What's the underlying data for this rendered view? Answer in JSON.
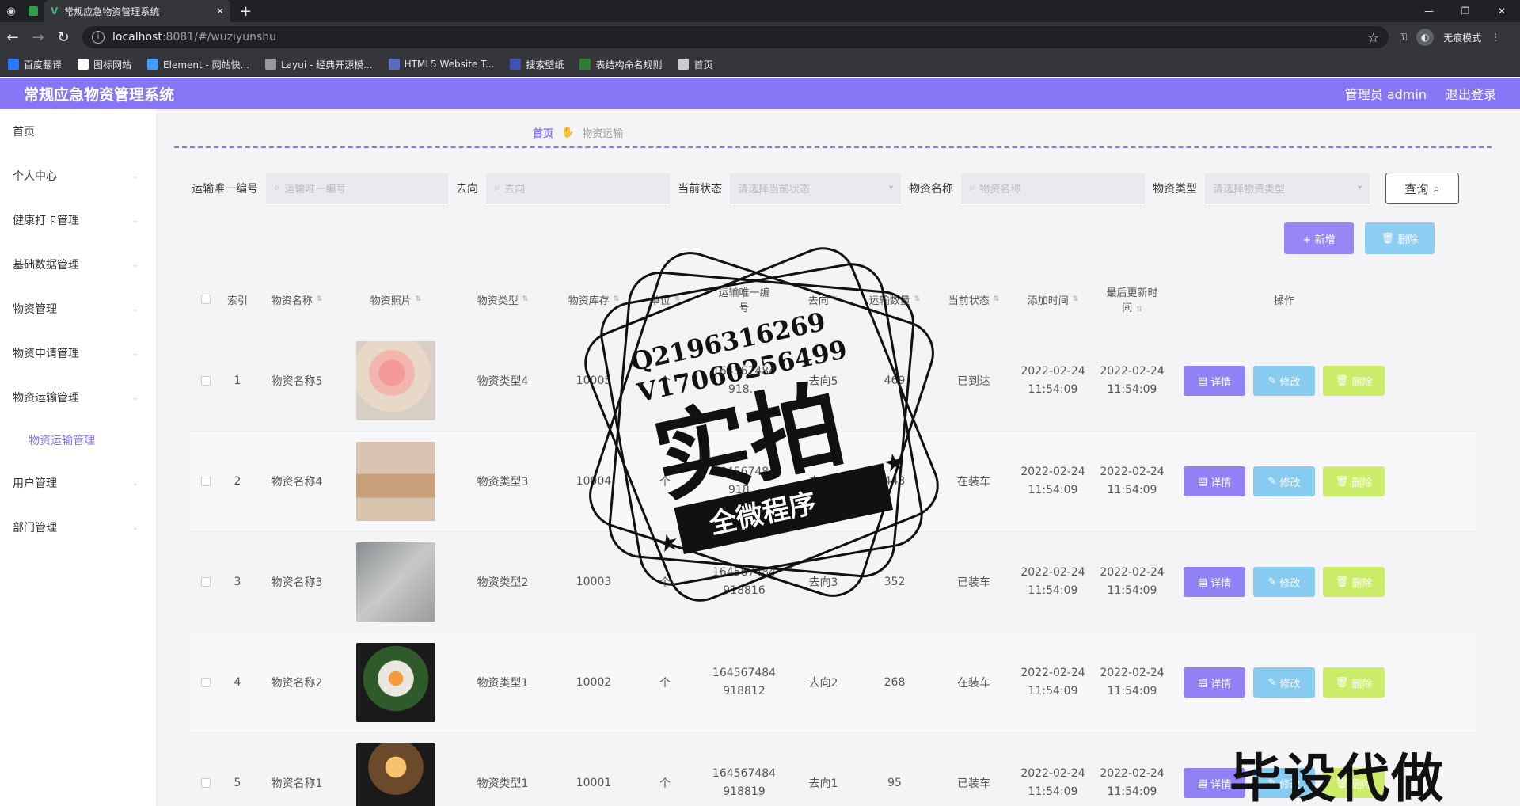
{
  "browser": {
    "tab_title": "常规应急物资管理系统",
    "url_host": "localhost",
    "url_path": ":8081/#/wuziyunshu",
    "incognito_label": "无痕模式",
    "bookmarks": [
      {
        "label": "百度翻译",
        "color": "#2979ff"
      },
      {
        "label": "图标网站",
        "color": "#ffffff"
      },
      {
        "label": "Element - 网站快...",
        "color": "#409eff"
      },
      {
        "label": "Layui - 经典开源模...",
        "color": "#999999"
      },
      {
        "label": "HTML5 Website T...",
        "color": "#5c6bc0"
      },
      {
        "label": "搜索壁纸",
        "color": "#3f51b5"
      },
      {
        "label": "表结构命名规则",
        "color": "#2e7d32"
      },
      {
        "label": "首页",
        "color": "#cccccc"
      }
    ]
  },
  "header": {
    "title": "常规应急物资管理系统",
    "user": "管理员 admin",
    "logout": "退出登录"
  },
  "sidebar": {
    "items": [
      {
        "label": "首页",
        "has_arrow": false
      },
      {
        "label": "个人中心",
        "has_arrow": true
      },
      {
        "label": "健康打卡管理",
        "has_arrow": true
      },
      {
        "label": "基础数据管理",
        "has_arrow": true
      },
      {
        "label": "物资管理",
        "has_arrow": true
      },
      {
        "label": "物资申请管理",
        "has_arrow": true
      },
      {
        "label": "物资运输管理",
        "has_arrow": true
      }
    ],
    "sub_item": "物资运输管理",
    "items_after": [
      {
        "label": "用户管理",
        "has_arrow": true
      },
      {
        "label": "部门管理",
        "has_arrow": true
      }
    ]
  },
  "breadcrumb": {
    "home": "首页",
    "current": "物资运输"
  },
  "search": {
    "f1_label": "运输唯一编号",
    "f1_placeholder": "运输唯一编号",
    "f2_label": "去向",
    "f2_placeholder": "去向",
    "f3_label": "当前状态",
    "f3_placeholder": "请选择当前状态",
    "f4_label": "物资名称",
    "f4_placeholder": "物资名称",
    "f5_label": "物资类型",
    "f5_placeholder": "请选择物资类型",
    "query": "查询"
  },
  "actions": {
    "add": "+ 新增",
    "delete": "删除"
  },
  "table": {
    "headers": {
      "index": "索引",
      "name": "物资名称",
      "photo": "物资照片",
      "type": "物资类型",
      "stock": "物资库存",
      "unit": "单位",
      "transport_no_1": "运输唯一编",
      "transport_no_2": "号",
      "dest": "去向",
      "qty": "运输数量",
      "status": "当前状态",
      "added": "添加时间",
      "updated_1": "最后更新时",
      "updated_2": "间",
      "ops": "操作"
    },
    "op_labels": {
      "detail": "详情",
      "edit": "修改",
      "delete": "删除"
    },
    "rows": [
      {
        "index": "1",
        "name": "物资名称5",
        "type": "物资类型4",
        "stock": "10005",
        "unit": "个",
        "no1": "164567484",
        "no2": "918...",
        "dest": "去向5",
        "qty": "469",
        "status": "已到达",
        "add_d": "2022-02-24",
        "add_t": "11:54:09",
        "upd_d": "2022-02-24",
        "upd_t": "11:54:09",
        "photo": "flower"
      },
      {
        "index": "2",
        "name": "物资名称4",
        "type": "物资类型3",
        "stock": "10004",
        "unit": "个",
        "no1": "164567484",
        "no2": "918...",
        "dest": "去向4",
        "qty": "443",
        "status": "在装车",
        "add_d": "2022-02-24",
        "add_t": "11:54:09",
        "upd_d": "2022-02-24",
        "upd_t": "11:54:09",
        "photo": "box"
      },
      {
        "index": "3",
        "name": "物资名称3",
        "type": "物资类型2",
        "stock": "10003",
        "unit": "个",
        "no1": "164567484",
        "no2": "918816",
        "dest": "去向3",
        "qty": "352",
        "status": "已装车",
        "add_d": "2022-02-24",
        "add_t": "11:54:09",
        "upd_d": "2022-02-24",
        "upd_t": "11:54:09",
        "photo": "gray"
      },
      {
        "index": "4",
        "name": "物资名称2",
        "type": "物资类型1",
        "stock": "10002",
        "unit": "个",
        "no1": "164567484",
        "no2": "918812",
        "dest": "去向2",
        "qty": "268",
        "status": "在装车",
        "add_d": "2022-02-24",
        "add_t": "11:54:09",
        "upd_d": "2022-02-24",
        "upd_t": "11:54:09",
        "photo": "bouquet"
      },
      {
        "index": "5",
        "name": "物资名称1",
        "type": "物资类型1",
        "stock": "10001",
        "unit": "个",
        "no1": "164567484",
        "no2": "918819",
        "dest": "去向1",
        "qty": "95",
        "status": "已装车",
        "add_d": "2022-02-24",
        "add_t": "11:54:09",
        "upd_d": "2022-02-24",
        "upd_t": "11:54:09",
        "photo": "dark"
      }
    ]
  },
  "watermark": {
    "qq": "Q2196316269",
    "vx": "V17060256499",
    "main": "实拍",
    "ribbon": "全微程序",
    "corner": "毕设代做"
  }
}
